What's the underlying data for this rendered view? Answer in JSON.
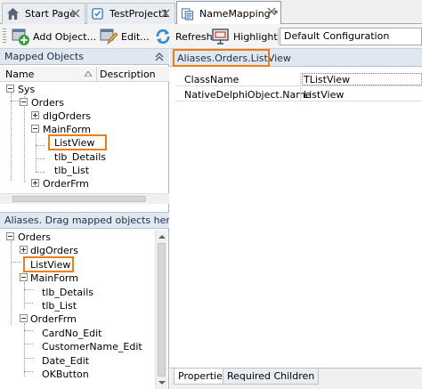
{
  "tabs": [
    {
      "label": "Start Page"
    },
    {
      "label": "TestProject1"
    },
    {
      "label": "NameMapping *"
    }
  ],
  "toolbar": {
    "add_object_label": "Add Object...",
    "edit_label": "Edit...",
    "refresh_label": "Refresh",
    "highlight_label": "Highlight",
    "configuration_value": "Default Configuration"
  },
  "mapped_objects": {
    "title": "Mapped Objects",
    "columns": {
      "name": "Name",
      "description": "Description"
    },
    "tree": {
      "sys": "Sys",
      "orders": "Orders",
      "dlg_orders": "dlgOrders",
      "main_form": "MainForm",
      "list_view": "ListView",
      "tlb_details": "tlb_Details",
      "tlb_list": "tlb_List",
      "order_frm": "OrderFrm"
    }
  },
  "aliases": {
    "title": "Aliases. Drag mapped objects here.",
    "tree": {
      "orders": "Orders",
      "dlg_orders": "dlgOrders",
      "list_view": "ListView",
      "main_form": "MainForm",
      "tlb_details": "tlb_Details",
      "tlb_list": "tlb_List",
      "order_frm": "OrderFrm",
      "card_no_edit": "CardNo_Edit",
      "customer_name_edit": "CustomerName_Edit",
      "date_edit": "Date_Edit",
      "ok_button": "OKButton"
    }
  },
  "details": {
    "path": "Aliases.Orders.ListView",
    "properties": [
      {
        "name": "ClassName",
        "value": "TListView"
      },
      {
        "name": "NativeDelphiObject.Name",
        "value": "ListView"
      }
    ],
    "bottom_tabs": [
      {
        "label": "Properties"
      },
      {
        "label": "Required Children"
      }
    ]
  },
  "colors": {
    "highlight_border": "#f07d12",
    "panel_header": "#dfe7f1"
  }
}
